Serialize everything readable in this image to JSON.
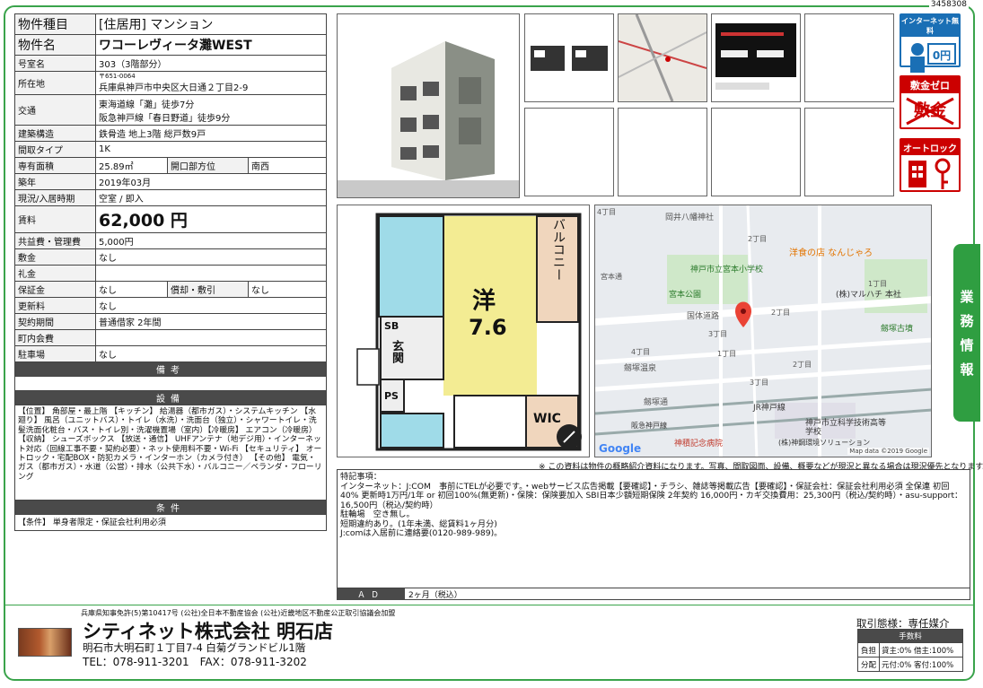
{
  "doc_id": "3458308",
  "spec": {
    "type_label": "物件種目",
    "type_value": "[住居用] マンション",
    "name_label": "物件名",
    "name_value": "ワコーレヴィータ灘WEST",
    "room_label": "号室名",
    "room_value": "303（3階部分）",
    "addr_label": "所在地",
    "zip": "〒651-0064",
    "addr_value": "兵庫県神戸市中央区大日通２丁目2-9",
    "traffic_label": "交通",
    "traffic_1": "東海道線「灘」徒歩7分",
    "traffic_2": "阪急神戸線「春日野道」徒歩9分",
    "struct_label": "建築構造",
    "struct_value": "鉄骨造 地上3階 総戸数9戸",
    "layout_label": "間取タイプ",
    "layout_value": "1K",
    "area_label": "専有面積",
    "area_value": "25.89㎡",
    "opening_label": "開口部方位",
    "opening_value": "南西",
    "built_label": "築年",
    "built_value": "2019年03月",
    "status_label": "現況/入居時期",
    "status_value": "空室 / 即入",
    "rent_label": "賃料",
    "rent_value": "62,000 円",
    "fee_label": "共益費・管理費",
    "fee_value": "5,000円",
    "deposit_label": "敷金",
    "deposit_value": "なし",
    "keymoney_label": "礼金",
    "keymoney_value": "",
    "guarantee_label": "保証金",
    "guarantee_value": "なし",
    "amort_label": "償却・敷引",
    "amort_value": "なし",
    "renew_label": "更新料",
    "renew_value": "なし",
    "contract_label": "契約期間",
    "contract_value": "普通借家 2年間",
    "community_label": "町内会費",
    "community_value": "",
    "parking_label": "駐車場",
    "parking_value": "なし",
    "remarks_header": "備考",
    "equipment_header": "設備",
    "equipment_text": "【位置】 角部屋・最上階 【キッチン】 給湯器（都市ガス）・システムキッチン 【水廻り】 風呂（ユニットバス）・トイレ（水洗）・洗面台（独立）・シャワートイレ・洗髪洗面化粧台・バス・トイレ別・洗濯機置場（室内）【冷暖房】 エアコン（冷暖房） 【収納】 シューズボックス 【放送・通信】 UHFアンテナ（地デジ用）・インターネット対応（回線工事不要・契約必要）・ネット使用料不要・Wi-Fi 【セキュリティ】 オートロック・宅配BOX・防犯カメラ・インターホン（カメラ付き） 【その他】 電気・ガス（都市ガス）・水道（公営）・排水（公共下水）・バルコニー／ベランダ・フローリング",
    "conditions_header": "条件",
    "conditions_text": "【条件】 単身者限定・保証会社利用必須"
  },
  "badges": {
    "internet": "インターネット無料",
    "internet_sub": "0円",
    "deposit_zero": "敷金ゼロ",
    "deposit_word": "敷金",
    "autolock": "オートロック"
  },
  "floorplan": {
    "balcony": "バルコニー",
    "room_kind": "洋",
    "room_size": "7.6",
    "sb": "SB",
    "entrance": "玄関",
    "ps": "PS",
    "wic": "WIC"
  },
  "map": {
    "labels": [
      "4丁目",
      "岡井八幡神社",
      "2丁目",
      "洋食の店 なんじゃろ",
      "宮本通",
      "神戸市立宮本小学校",
      "1丁目",
      "宮本公園",
      "(株)マルハチ 本社",
      "国体道路",
      "2丁目",
      "3丁目",
      "劔塚古墳",
      "4丁目",
      "1丁目",
      "劔塚温泉",
      "2丁目",
      "3丁目",
      "劔塚通",
      "JR神戸線",
      "阪急神戸線",
      "神戸市立科学技術高等学校",
      "神積記念病院",
      "(株)神鋼環境ソリューション",
      "Map data ©2019 Google"
    ],
    "google": "Google"
  },
  "side_tab": [
    "業",
    "務",
    "情",
    "報"
  ],
  "disclaimer": "※ この資料は物件の概略紹介資料になります。写真、間取図面、設備、概要などが現況と異なる場合は現況優先となります。",
  "notes": {
    "header": "特記事項：",
    "lines": [
      "インターネット：J:COM　事前にTELが必要です。・webサービス広告掲載【要確認】・チラシ、雑誌等掲載広告【要確認】・保証会社：保証会社利用必須 全保連 初回40% 更新時1万円/1年 or 初回100%(無更新)・保険：保険要加入 SBI日本少額短期保険 2年契約 16,000円・カギ交換費用：25,300円（税込/契約時）・asu-support：16,500円（税込/契約時）",
      "駐輪場　空き無し。",
      "短期違約あり。(1年未満、総賃料1ヶ月分)",
      "J:comは入居前に連絡要(0120-989-989)。"
    ],
    "ad_label": "ＡＤ",
    "ad_value": "2ヶ月（税込）"
  },
  "footer": {
    "license": "兵庫県知事免許(5)第10417号 (公社)全日本不動産協会 (公社)近畿地区不動産公正取引協議会加盟",
    "company": "シティネット株式会社 明石店",
    "address": "明石市大明石町１丁目7-4 白菊グランドビル1階",
    "tel": "TEL：078-911-3201　FAX：078-911-3202",
    "deal_type": "取引態様：専任媒介",
    "fee_header": "手数料",
    "burden_label": "負担",
    "burden_value": "貸主:0% 借主:100%",
    "share_label": "分配",
    "share_value": "元付:0% 客付:100%"
  }
}
